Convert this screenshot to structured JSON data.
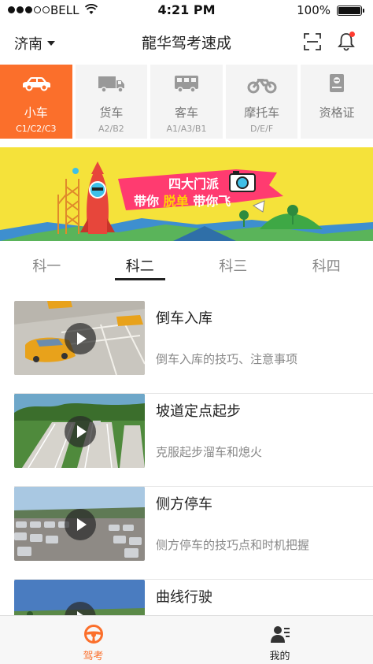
{
  "status": {
    "carrier": "BELL",
    "time": "4:21 PM",
    "battery": "100%"
  },
  "nav": {
    "city": "济南",
    "title": "龍华驾考速成"
  },
  "categories": [
    {
      "label": "小车",
      "sub": "C1/C2/C3",
      "icon": "car-icon"
    },
    {
      "label": "货车",
      "sub": "A2/B2",
      "icon": "truck-icon"
    },
    {
      "label": "客车",
      "sub": "A1/A3/B1",
      "icon": "bus-icon"
    },
    {
      "label": "摩托车",
      "sub": "D/E/F",
      "icon": "motorcycle-icon"
    },
    {
      "label": "资格证",
      "sub": "",
      "icon": "certificate-icon"
    }
  ],
  "banner": {
    "line1": "四大门派",
    "line2a": "带你",
    "line2b": "脱单",
    "line2c": "带你飞"
  },
  "subjects": [
    {
      "label": "科一"
    },
    {
      "label": "科二"
    },
    {
      "label": "科三"
    },
    {
      "label": "科四"
    }
  ],
  "lessons": [
    {
      "title": "倒车入库",
      "desc": "倒车入库的技巧、注意事项"
    },
    {
      "title": "坡道定点起步",
      "desc": "克服起步溜车和熄火"
    },
    {
      "title": "侧方停车",
      "desc": "侧方停车的技巧点和时机把握"
    },
    {
      "title": "曲线行驶",
      "desc": ""
    }
  ],
  "tabbar": [
    {
      "label": "驾考",
      "icon": "steering-wheel-icon"
    },
    {
      "label": "我的",
      "icon": "profile-icon"
    }
  ],
  "colors": {
    "accent": "#fb6f2b",
    "banner_bg": "#f5e23a",
    "badge": "#ff3b30"
  }
}
